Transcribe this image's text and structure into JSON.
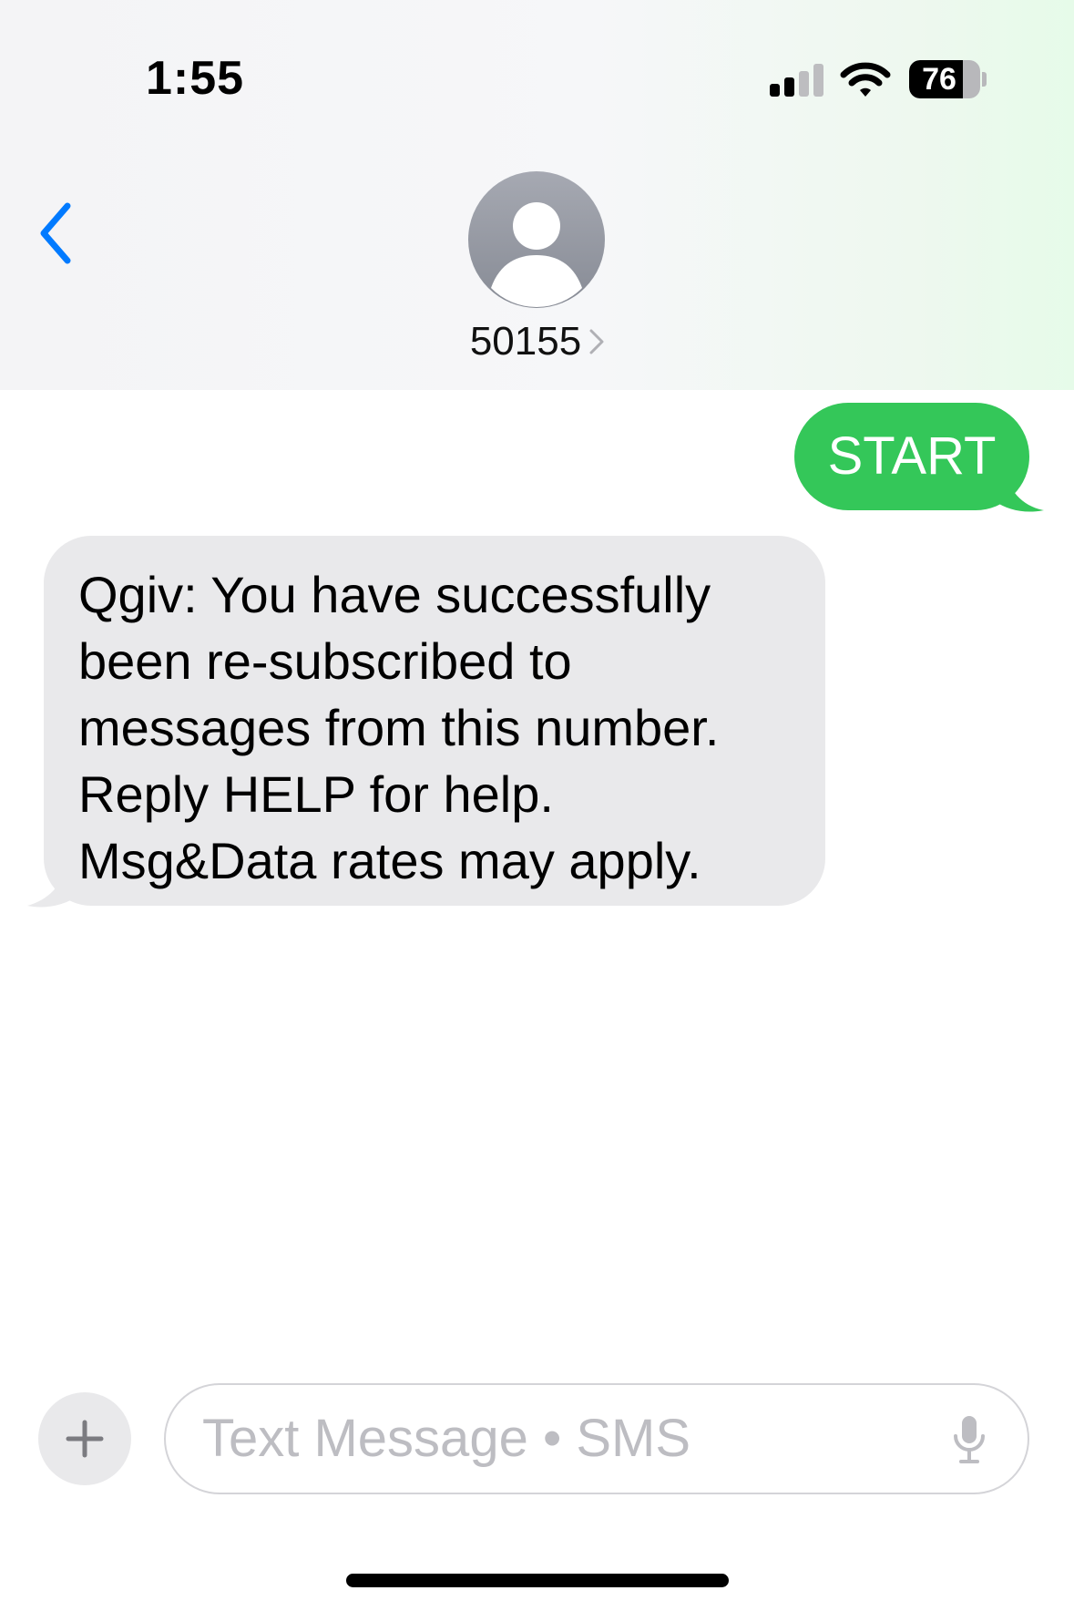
{
  "status_bar": {
    "time": "1:55",
    "battery_level": "76",
    "battery_fraction": 0.76,
    "signal_bars_active": 2,
    "signal_bars_total": 4
  },
  "header": {
    "back_icon": "chevron-left-icon",
    "avatar_icon": "person-icon",
    "contact_name": "50155",
    "contact_chevron_icon": "chevron-right-icon"
  },
  "messages": [
    {
      "direction": "outgoing",
      "text": "START"
    },
    {
      "direction": "incoming",
      "text": "Qgiv: You have successfully\nbeen re-subscribed to\nmessages from this number.\nReply HELP for help.\nMsg&Data rates may apply."
    }
  ],
  "composer": {
    "plus_icon": "plus-icon",
    "placeholder": "Text Message • SMS",
    "mic_icon": "microphone-icon"
  },
  "colors": {
    "accent_blue": "#007aff",
    "outgoing_bubble": "#34c759",
    "incoming_bubble": "#e9e9eb"
  }
}
